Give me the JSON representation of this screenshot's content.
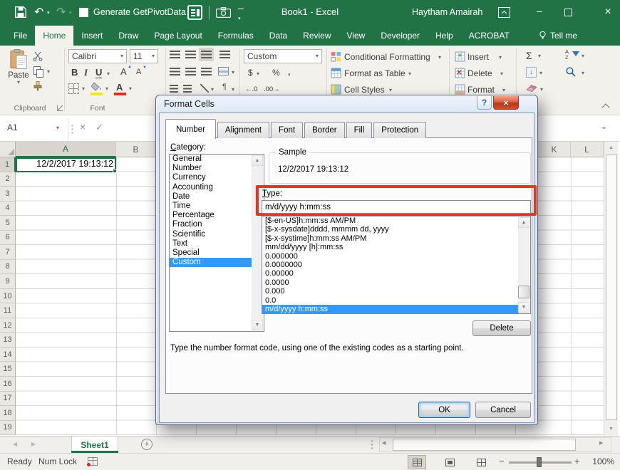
{
  "titlebar": {
    "qat_checkbox_label": "Generate GetPivotData",
    "workbook_title": "Book1 - Excel",
    "user_name": "Haytham Amairah"
  },
  "icons": {
    "dropdown": "▾",
    "undo": "↶",
    "redo": "↷",
    "scroll_up": "▲",
    "scroll_down": "▼",
    "scroll_left": "◀",
    "scroll_right": "▶",
    "cancel_entry": "×",
    "enter_entry": "✓",
    "expand_formula_bar": "⌄",
    "help": "?",
    "close": "×",
    "minimize": "–",
    "autosum": "Σ",
    "sort_a": "A",
    "sort_z": "Z",
    "paragraph": "¶",
    "add_sheet": "+",
    "zoom_out": "−",
    "zoom_in": "+",
    "increase_decimal": "←.0",
    "decrease_decimal": ".00→",
    "font_grow": "A",
    "font_shrink": "A"
  },
  "ribbon": {
    "tabs": [
      "File",
      "Home",
      "Insert",
      "Draw",
      "Page Layout",
      "Formulas",
      "Data",
      "Review",
      "View",
      "Developer",
      "Help",
      "ACROBAT"
    ],
    "active_tab_index": 1,
    "tell_me": "Tell me",
    "groups": {
      "clipboard": {
        "label": "Clipboard",
        "paste": "Paste"
      },
      "font": {
        "label": "Font",
        "font_name": "Calibri",
        "font_size": "11",
        "bold": "B",
        "italic": "I",
        "underline": "U"
      },
      "number": {
        "format": "Custom",
        "currency": "$",
        "percent": "%",
        "comma": ","
      },
      "styles": {
        "conditional_formatting": "Conditional Formatting",
        "format_as_table": "Format as Table",
        "cell_styles": "Cell Styles"
      },
      "cells": {
        "insert": "Insert",
        "delete": "Delete",
        "format": "Format"
      }
    }
  },
  "formula_bar": {
    "name_box": "A1"
  },
  "sheet": {
    "columns": [
      "A",
      "B",
      "K",
      "L"
    ],
    "row_numbers": [
      1,
      2,
      3,
      4,
      5,
      6,
      7,
      8,
      9,
      10,
      11,
      12,
      13,
      14,
      15,
      16,
      17,
      18,
      19
    ],
    "selected_row_index": 0,
    "a1_value": "12/2/2017 19:13:12",
    "tab_name": "Sheet1"
  },
  "status_bar": {
    "mode": "Ready",
    "num_lock": "Num Lock",
    "zoom_level": "100%"
  },
  "dialog": {
    "title": "Format Cells",
    "tabs": [
      "Number",
      "Alignment",
      "Font",
      "Border",
      "Fill",
      "Protection"
    ],
    "active_tab_index": 0,
    "category_label": "Category:",
    "categories": [
      "General",
      "Number",
      "Currency",
      "Accounting",
      "Date",
      "Time",
      "Percentage",
      "Fraction",
      "Scientific",
      "Text",
      "Special",
      "Custom"
    ],
    "selected_category_index": 11,
    "sample_label": "Sample",
    "sample_value": "12/2/2017 19:13:12",
    "type_label": "Type:",
    "type_value": "m/d/yyyy h:mm:ss",
    "format_codes": [
      "[$-en-US]h:mm:ss AM/PM",
      "[$-x-sysdate]dddd, mmmm dd, yyyy",
      "[$-x-systime]h:mm:ss AM/PM",
      "mm/dd/yyyy [h]:mm:ss",
      "0.000000",
      "0.0000000",
      "0.00000",
      "0.0000",
      "0.000",
      "0.0",
      "m/d/yyyy h:mm:ss"
    ],
    "selected_format_index": 10,
    "delete_button": "Delete",
    "description": "Type the number format code, using one of the existing codes as a starting point.",
    "ok_button": "OK",
    "cancel_button": "Cancel"
  },
  "colors": {
    "excel_green": "#217346",
    "selection_blue": "#3399ff",
    "highlight_red": "#e8331f"
  }
}
